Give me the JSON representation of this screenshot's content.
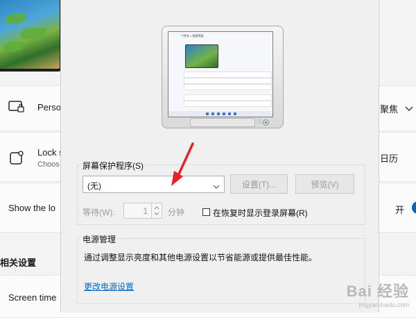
{
  "settings_page": {
    "rows": [
      {
        "label": "Perso",
        "right_value": "聚焦",
        "icon": "lock-screen-icon"
      },
      {
        "label": "Lock s",
        "sub": "Choos",
        "right_value": "日历",
        "icon": "app-tile-icon"
      },
      {
        "label": "Show the lo",
        "right_value": "开"
      }
    ],
    "section_title": "相关设置",
    "timeout_label": "Screen time"
  },
  "dialog": {
    "preview": {
      "mini_title": "个性化 > 锁屏界面"
    },
    "screensaver_group": {
      "title": "屏幕保护程序(S)",
      "selected": "(无)",
      "settings_button": "设置(T)...",
      "preview_button": "预览(V)",
      "wait_label": "等待(W):",
      "wait_value": "1",
      "wait_unit": "分钟",
      "resume_checkbox_label": "在恢复时显示登录屏幕(R)",
      "resume_checked": false
    },
    "power_group": {
      "title": "电源管理",
      "description": "通过调整显示亮度和其他电源设置以节省能源或提供最佳性能。",
      "link": "更改电源设置"
    }
  },
  "colors": {
    "link": "#0066cc",
    "annotation_arrow": "#e8202a"
  },
  "watermark": {
    "text": "Bai 经验",
    "sub": "jingyan.baidu.com"
  }
}
